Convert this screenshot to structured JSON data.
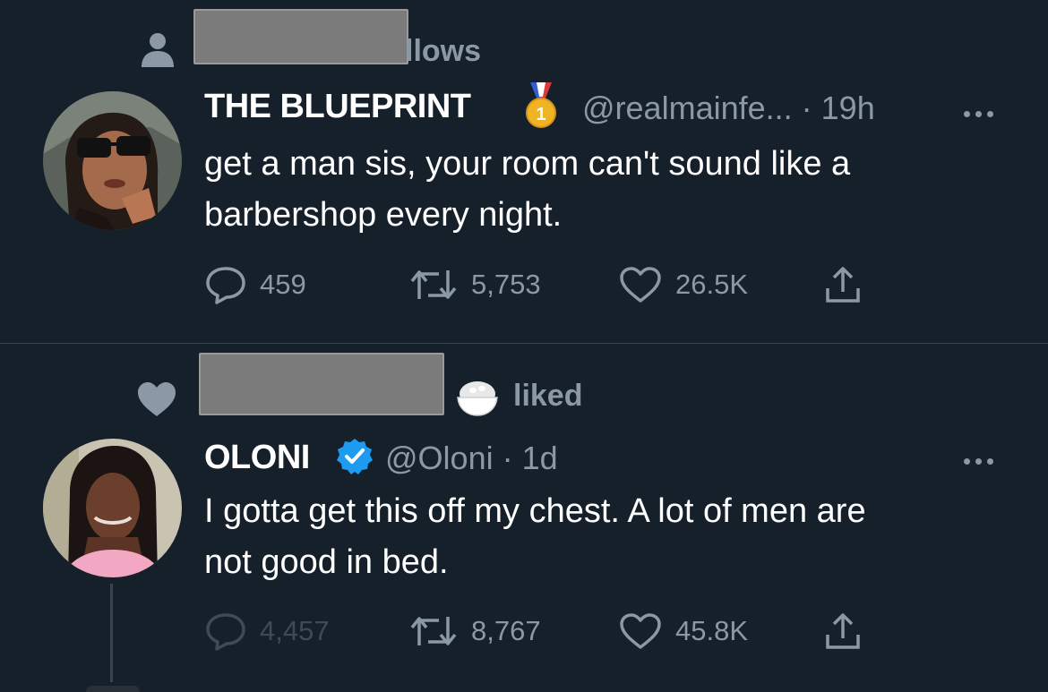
{
  "tweet1": {
    "social_context": "llows",
    "display_name": "THE BLUEPRINT",
    "badge_icon": "gold-medal-icon",
    "handle": "@realmainfe...",
    "time": "· 19h",
    "text_line1": "get a man sis, your room can't sound like a",
    "text_line2": "barbershop every night.",
    "replies": "459",
    "retweets": "5,753",
    "likes": "26.5K"
  },
  "tweet2": {
    "social_context": "liked",
    "context_emoji": "rice-bowl-icon",
    "display_name": "OLONI",
    "verified_icon": "verified-badge-icon",
    "verified_color": "#1d9bf0",
    "handle": "@Oloni",
    "time": "· 1d",
    "text_line1": "I gotta get this off my chest. A lot of men are",
    "text_line2": "not good in bed.",
    "replies": "4,457",
    "retweets": "8,767",
    "likes": "45.8K"
  },
  "colors": {
    "background": "#15202b",
    "muted": "#8b98a5",
    "divider": "#38444d"
  }
}
